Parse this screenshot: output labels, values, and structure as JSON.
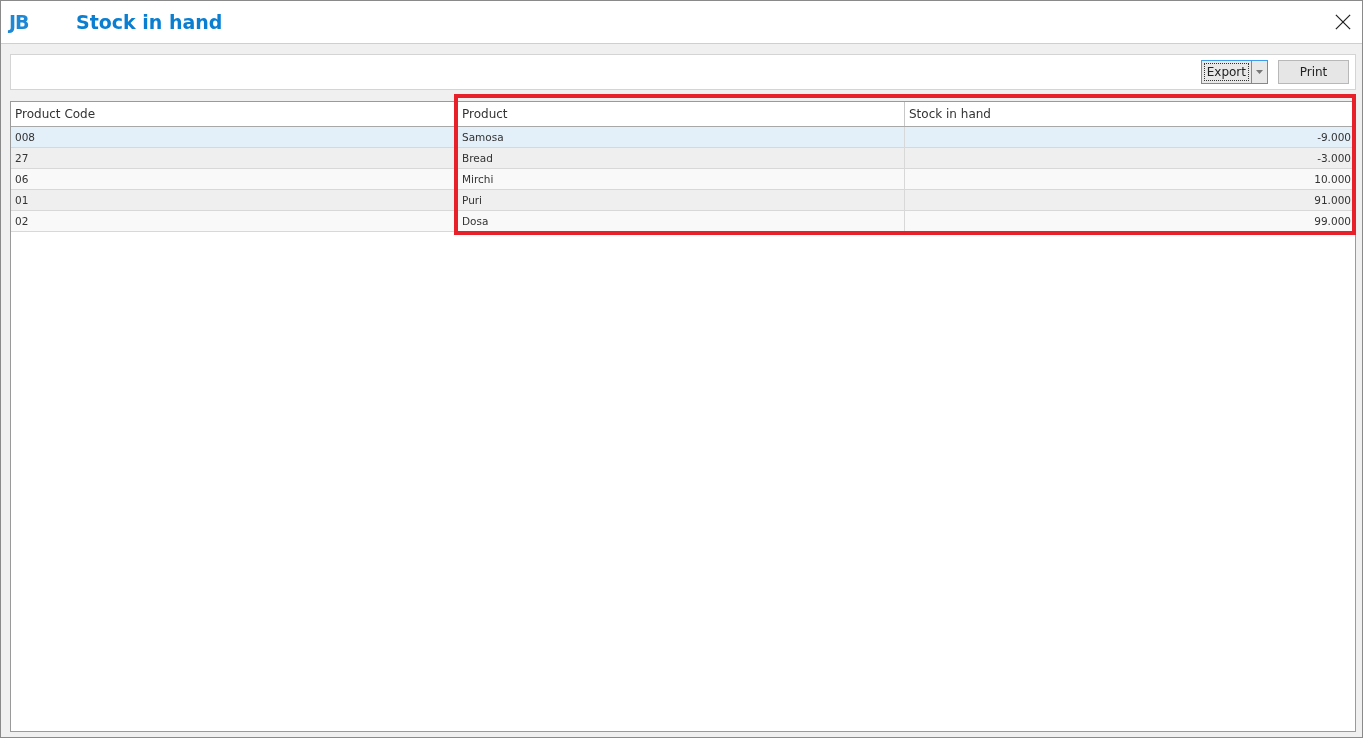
{
  "window": {
    "title": "Stock in hand",
    "logo": "JB"
  },
  "toolbar": {
    "export": "Export",
    "print": "Print"
  },
  "table": {
    "columns": [
      {
        "label": "Product Code",
        "highlighted": false
      },
      {
        "label": "Product",
        "highlighted": true
      },
      {
        "label": "Stock in hand",
        "highlighted": true
      }
    ],
    "rows": [
      {
        "cells": [
          "008",
          "Samosa",
          "-9.000"
        ],
        "selected": true
      },
      {
        "cells": [
          "27",
          "Bread",
          "-3.000"
        ],
        "selected": false
      },
      {
        "cells": [
          "06",
          "Mirchi",
          "10.000"
        ],
        "selected": false
      },
      {
        "cells": [
          "01",
          "Puri",
          "91.000"
        ],
        "selected": false
      },
      {
        "cells": [
          "02",
          "Dosa",
          "99.000"
        ],
        "selected": false
      }
    ]
  }
}
